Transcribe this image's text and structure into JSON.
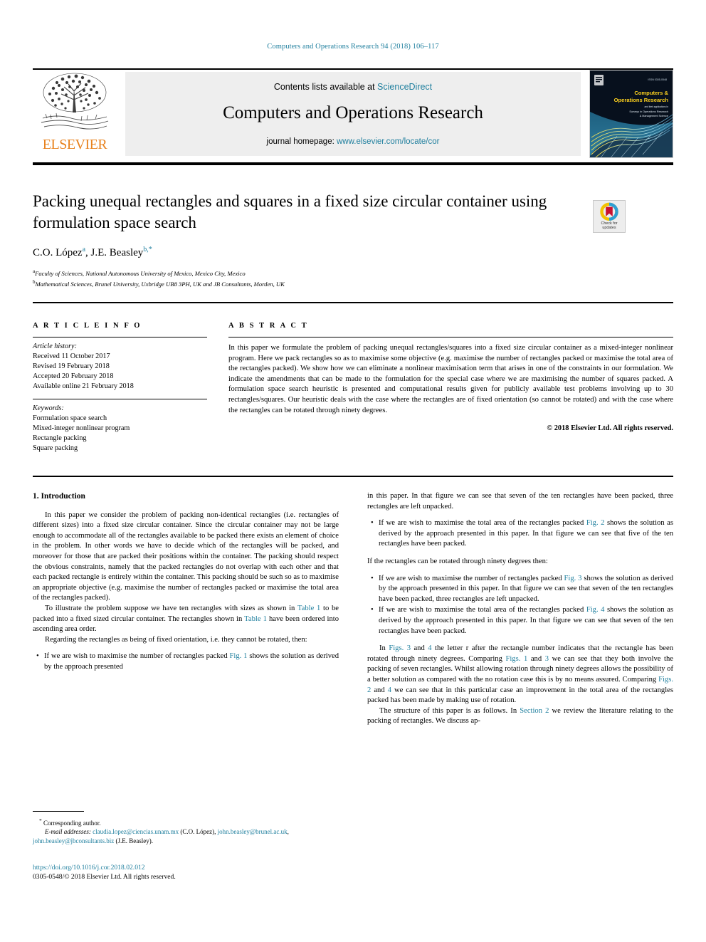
{
  "running_head": "Computers and Operations Research 94 (2018) 106–117",
  "masthead": {
    "contents_prefix": "Contents lists available at ",
    "sciencedirect": "ScienceDirect",
    "journal_title": "Computers and Operations Research",
    "homepage_prefix": "journal homepage: ",
    "homepage_url": "www.elsevier.com/locate/cor",
    "publisher": "ELSEVIER",
    "cover": {
      "line1": "Computers &",
      "line2": "Operations Research",
      "sub1": "An International Journal",
      "sub2": "Surveys in Operations Research",
      "sub3": "& Management Science"
    }
  },
  "crossmark": {
    "line1": "Check for",
    "line2": "updates"
  },
  "article": {
    "title": "Packing unequal rectangles and squares in a fixed size circular container using formulation space search",
    "authors": [
      {
        "name": "C.O. López",
        "sup": "a"
      },
      {
        "name": "J.E. Beasley",
        "sup": "b,*"
      }
    ],
    "affiliations": [
      {
        "sup": "a",
        "text": "Faculty of Sciences, National Autonomous University of Mexico, Mexico City, Mexico"
      },
      {
        "sup": "b",
        "text": "Mathematical Sciences, Brunel University, Uxbridge UB8 3PH, UK and JB Consultants, Morden, UK"
      }
    ]
  },
  "info": {
    "heading": "A R T I C L E   I N F O",
    "history_label": "Article history:",
    "history": [
      "Received 11 October 2017",
      "Revised 19 February 2018",
      "Accepted 20 February 2018",
      "Available online 21 February 2018"
    ],
    "keywords_label": "Keywords:",
    "keywords": [
      "Formulation space search",
      "Mixed-integer nonlinear program",
      "Rectangle packing",
      "Square packing"
    ]
  },
  "abstract": {
    "heading": "A B S T R A C T",
    "text": "In this paper we formulate the problem of packing unequal rectangles/squares into a fixed size circular container as a mixed-integer nonlinear program. Here we pack rectangles so as to maximise some objective (e.g. maximise the number of rectangles packed or maximise the total area of the rectangles packed). We show how we can eliminate a nonlinear maximisation term that arises in one of the constraints in our formulation. We indicate the amendments that can be made to the formulation for the special case where we are maximising the number of squares packed. A formulation space search heuristic is presented and computational results given for publicly available test problems involving up to 30 rectangles/squares. Our heuristic deals with the case where the rectangles are of fixed orientation (so cannot be rotated) and with the case where the rectangles can be rotated through ninety degrees.",
    "copyright": "© 2018 Elsevier Ltd. All rights reserved."
  },
  "body": {
    "section_heading": "1. Introduction",
    "left": {
      "p1": "In this paper we consider the problem of packing non-identical rectangles (i.e. rectangles of different sizes) into a fixed size circular container. Since the circular container may not be large enough to accommodate all of the rectangles available to be packed there exists an element of choice in the problem. In other words we have to decide which of the rectangles will be packed, and moreover for those that are packed their positions within the container. The packing should respect the obvious constraints, namely that the packed rectangles do not overlap with each other and that each packed rectangle is entirely within the container. This packing should be such so as to maximise an appropriate objective (e.g. maximise the number of rectangles packed or maximise the total area of the rectangles packed).",
      "p2_a": "To illustrate the problem suppose we have ten rectangles with sizes as shown in ",
      "p2_link1": "Table 1",
      "p2_b": " to be packed into a fixed sized circular container. The rectangles shown in ",
      "p2_link2": "Table 1",
      "p2_c": " have been ordered into ascending area order.",
      "p3": "Regarding the rectangles as being of fixed orientation, i.e. they cannot be rotated, then:",
      "b1_a": "If we are wish to maximise the number of rectangles packed ",
      "b1_link": "Fig. 1",
      "b1_b": " shows the solution as derived by the approach presented"
    },
    "right": {
      "b1_cont": "in this paper. In that figure we can see that seven of the ten rectangles have been packed, three rectangles are left unpacked.",
      "b2_a": "If we are wish to maximise the total area of the rectangles packed ",
      "b2_link": "Fig. 2",
      "b2_b": " shows the solution as derived by the approach presented in this paper. In that figure we can see that five of the ten rectangles have been packed.",
      "p4": "If the rectangles can be rotated through ninety degrees then:",
      "b3_a": "If we are wish to maximise the number of rectangles packed ",
      "b3_link": "Fig. 3",
      "b3_b": " shows the solution as derived by the approach presented in this paper. In that figure we can see that seven of the ten rectangles have been packed, three rectangles are left unpacked.",
      "b4_a": "If we are wish to maximise the total area of the rectangles packed ",
      "b4_link": "Fig. 4",
      "b4_b": " shows the solution as derived by the approach presented in this paper. In that figure we can see that seven of the ten rectangles have been packed.",
      "p5_a": "In ",
      "p5_link1": "Figs. 3",
      "p5_b": " and ",
      "p5_link2": "4",
      "p5_c": " the letter r after the rectangle number indicates that the rectangle has been rotated through ninety degrees. Comparing ",
      "p5_link3": "Figs. 1",
      "p5_d": " and ",
      "p5_link4": "3",
      "p5_e": " we can see that they both involve the packing of seven rectangles. Whilst allowing rotation through ninety degrees allows the possibility of a better solution as compared with the no rotation case this is by no means assured. Comparing ",
      "p5_link5": "Figs. 2",
      "p5_f": " and ",
      "p5_link6": "4",
      "p5_g": " we can see that in this particular case an improvement in the total area of the rectangles packed has been made by making use of rotation.",
      "p6_a": "The structure of this paper is as follows. In ",
      "p6_link": "Section 2",
      "p6_b": " we review the literature relating to the packing of rectangles. We discuss ap-"
    }
  },
  "footnote": {
    "corresponding": "Corresponding author.",
    "email_label": "E-mail addresses:",
    "email1": "claudia.lopez@ciencias.unam.mx",
    "email1_who": "(C.O. López),",
    "email2": "john.beasley@brunel.ac.uk",
    "email_sep": ", ",
    "email3": "john.beasley@jbconsultants.biz",
    "email3_who": "(J.E. Beasley)."
  },
  "doi": {
    "url": "https://doi.org/10.1016/j.cor.2018.02.012",
    "issn_line": "0305-0548/© 2018 Elsevier Ltd. All rights reserved."
  },
  "colors": {
    "link": "#1f7f9e",
    "elsevier_orange": "#e8821e",
    "masthead_bg": "#eeeeee"
  }
}
